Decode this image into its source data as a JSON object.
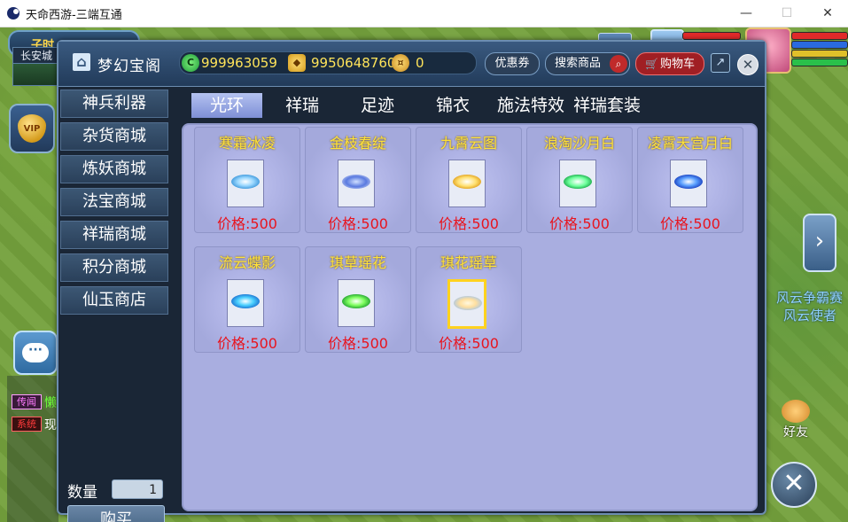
{
  "window": {
    "title": "天命西游-三端互通",
    "minimize": "—",
    "maximize": "☐",
    "close": "✕"
  },
  "hud": {
    "time_label": "子时",
    "location": "长安城",
    "chat_tags": {
      "rumor": "传闻",
      "system": "系统"
    },
    "chat_fragments": [
      "懒",
      "现"
    ],
    "npc_name": "风云争霸赛",
    "npc_title": "风云使者",
    "friend_label": "好友",
    "vip_badge": "VIP"
  },
  "shop": {
    "title": "梦幻宝阁",
    "currencies": [
      {
        "icon": "jade-icon",
        "value": "999963059"
      },
      {
        "icon": "ticket-icon",
        "value": "9950648760"
      },
      {
        "icon": "coin-icon",
        "value": "0"
      }
    ],
    "coupon_label": "优惠券",
    "search_label": "搜索商品",
    "cart_label": "购物车",
    "categories": [
      "神兵利器",
      "杂货商城",
      "炼妖商城",
      "法宝商城",
      "祥瑞商城",
      "积分商城",
      "仙玉商店"
    ],
    "tabs": [
      "光环",
      "祥瑞",
      "足迹",
      "锦衣",
      "施法特效",
      "祥瑞套装"
    ],
    "active_tab": "光环",
    "quantity_label": "数量",
    "quantity_value": "1",
    "buy_label": "购买",
    "items": [
      {
        "name": "寒霜冰凌",
        "price": "价格:500",
        "icon": "halo-icon"
      },
      {
        "name": "金枝春绽",
        "price": "价格:500",
        "icon": "halo-icon"
      },
      {
        "name": "九霄云图",
        "price": "价格:500",
        "icon": "halo-icon"
      },
      {
        "name": "浪淘沙月白",
        "price": "价格:500",
        "icon": "halo-icon"
      },
      {
        "name": "凌霄天宫月白",
        "price": "价格:500",
        "icon": "halo-icon"
      },
      {
        "name": "流云蝶影",
        "price": "价格:500",
        "icon": "halo-icon"
      },
      {
        "name": "琪草瑶花",
        "price": "价格:500",
        "icon": "halo-icon"
      },
      {
        "name": "琪花瑶草",
        "price": "价格:500",
        "icon": "halo-icon",
        "selected": true
      }
    ]
  },
  "colors": {
    "price": "#e8141e",
    "item_name": "#ffe23a",
    "currency": "#ffe45a",
    "active_tab": "#9aa8e6"
  }
}
